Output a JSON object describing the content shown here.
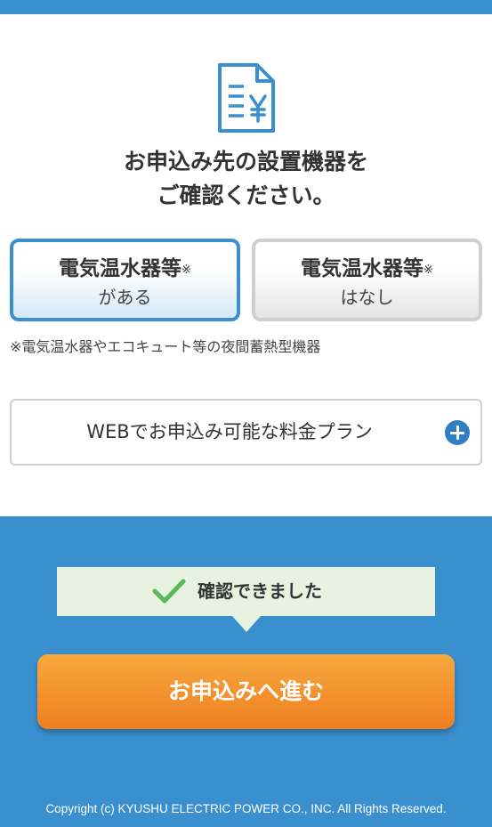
{
  "header": {
    "heading_line1": "お申込み先の設置機器を",
    "heading_line2": "ご確認ください。"
  },
  "choices": [
    {
      "title": "電気温水器等",
      "mark": "※",
      "sub": "がある",
      "selected": true
    },
    {
      "title": "電気温水器等",
      "mark": "※",
      "sub": "はなし",
      "selected": false
    }
  ],
  "note": "※電気温水器やエコキュート等の夜間蓄熱型機器",
  "plans": {
    "label": "WEBでお申込み可能な料金プラン"
  },
  "confirmation": {
    "text": "確認できました"
  },
  "proceed": {
    "label": "お申込みへ進む"
  },
  "footer": {
    "copyright": "Copyright (c) KYUSHU ELECTRIC POWER CO., INC. All Rights Reserved."
  },
  "colors": {
    "brand_blue": "#3a8fcf",
    "accent_orange": "#ef7f22",
    "confirm_green": "#5cb85c",
    "confirm_bg": "#e7f2e1"
  },
  "icons": {
    "document": "document-yen-icon",
    "expand": "plus-circle-icon",
    "check": "check-icon"
  }
}
